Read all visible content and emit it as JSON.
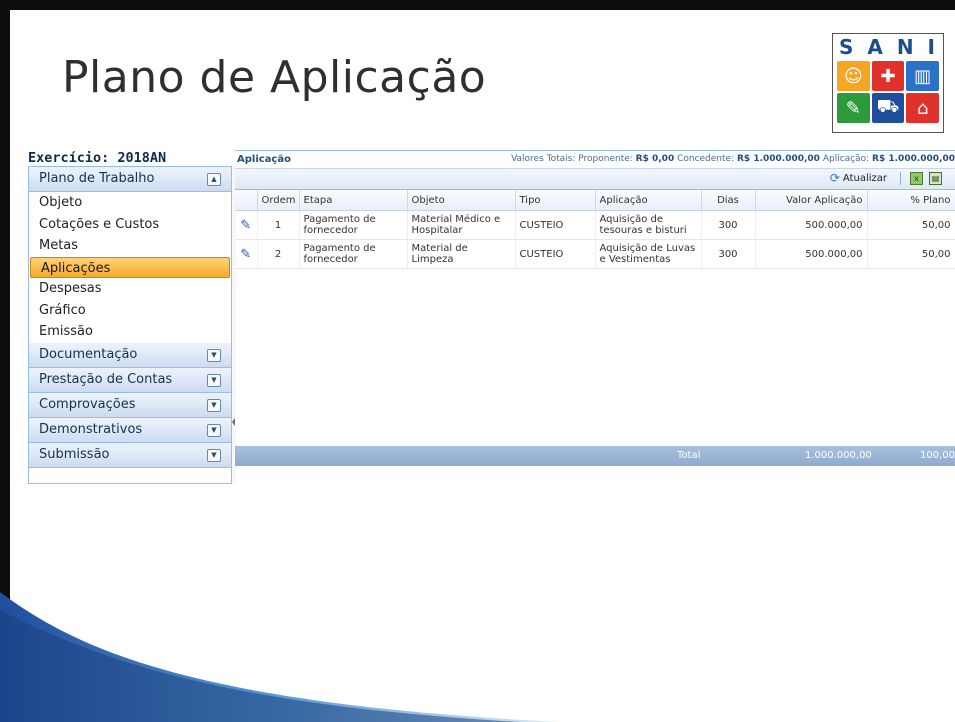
{
  "slide": {
    "title": "Plano de Aplicação"
  },
  "logo": {
    "text": [
      "S",
      "A",
      "N",
      "I"
    ]
  },
  "panel": {
    "exercicio": "Exercício: 2018AN",
    "accordion_open": {
      "label": "Plano de Trabalho",
      "toggle": "▲"
    },
    "menu_items": [
      "Objeto",
      "Cotações e Custos",
      "Metas",
      "Aplicações",
      "Despesas",
      "Gráfico",
      "Emissão"
    ],
    "active_item": "Aplicações",
    "collapsed_sections": [
      "Documentação",
      "Prestação de Contas",
      "Comprovações",
      "Demonstrativos",
      "Submissão"
    ],
    "collapsed_toggle": "▼"
  },
  "grid": {
    "title": "Aplicação",
    "totals": {
      "label": "Valores Totais:",
      "proponente_label": "Proponente:",
      "proponente_value": "R$ 0,00",
      "concedente_label": "Concedente:",
      "concedente_value": "R$ 1.000.000,00",
      "aplicacao_label": "Aplicação:",
      "aplicacao_value": "R$ 1.000.000,00"
    },
    "toolbar": {
      "refresh_label": "Atualizar"
    },
    "columns": [
      "",
      "Ordem",
      "Etapa",
      "Objeto",
      "Tipo",
      "Aplicação",
      "Dias",
      "Valor Aplicação",
      "% Plano"
    ],
    "rows": [
      [
        "1",
        "Pagamento de fornecedor",
        "Material Médico e Hospitalar",
        "CUSTEIO",
        "Aquisição de tesouras e bisturi",
        "300",
        "500.000,00",
        "50,00"
      ],
      [
        "2",
        "Pagamento de fornecedor",
        "Material de Limpeza",
        "CUSTEIO",
        "Aquisição de Luvas e Vestimentas",
        "300",
        "500.000,00",
        "50,00"
      ]
    ],
    "footer": {
      "label": "Total",
      "valor": "1.000.000,00",
      "percent": "100,00"
    }
  },
  "colors": {
    "accent": "#99bbe8",
    "active": "#f6a928",
    "swoosh": "#1f4e9c"
  }
}
